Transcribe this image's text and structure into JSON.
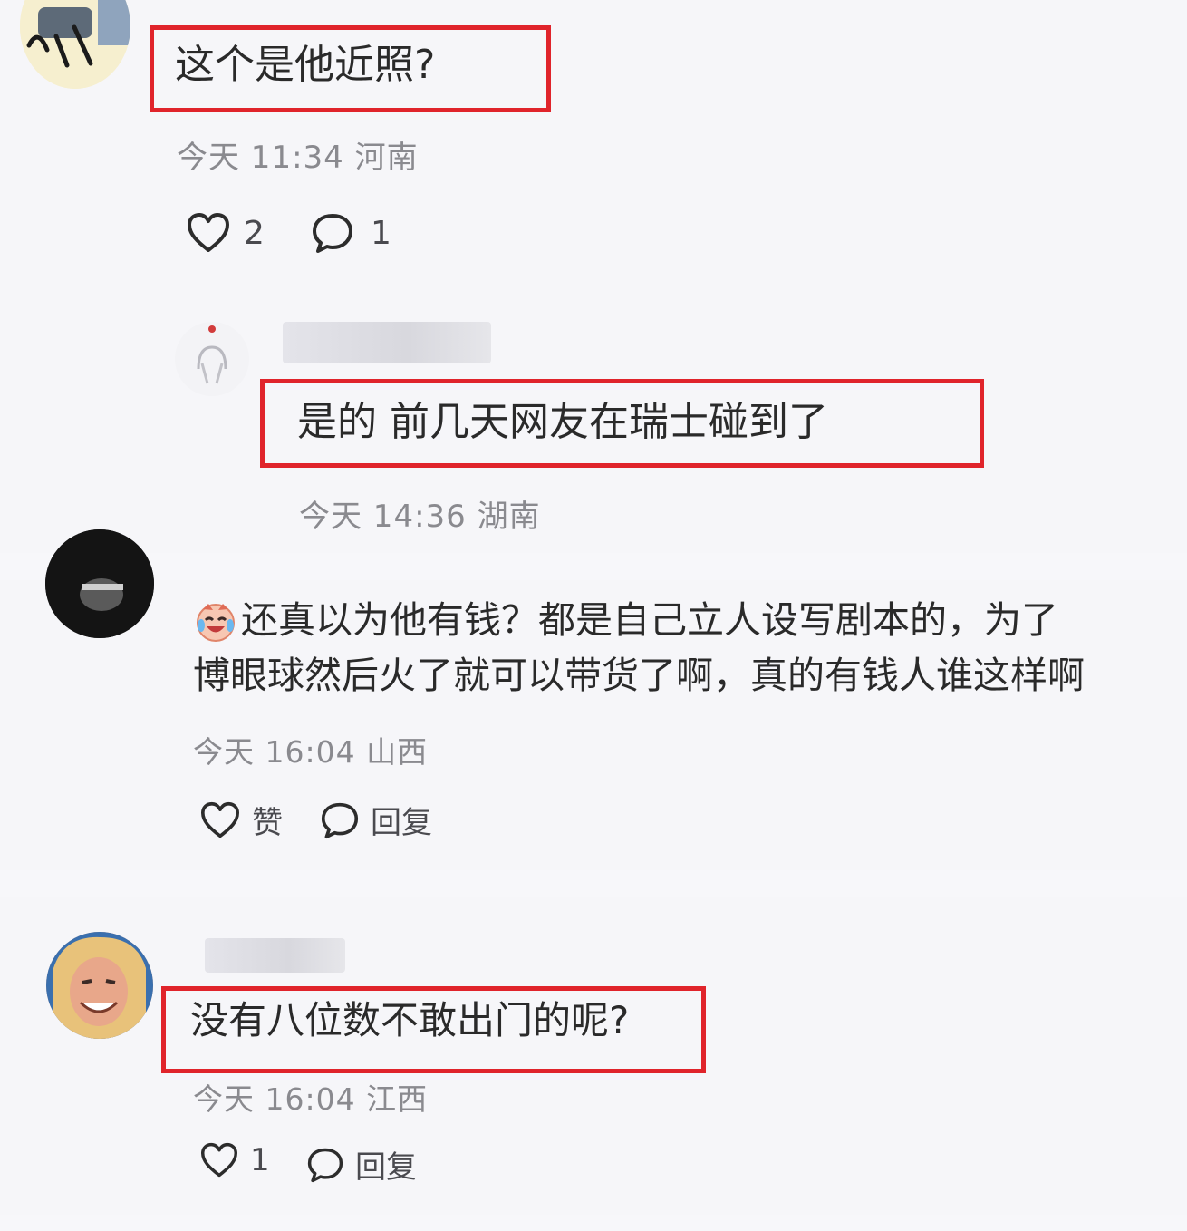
{
  "comments": [
    {
      "text": "这个是他近照?",
      "meta": "今天 11:34 河南",
      "like_label": "2",
      "reply_label": "1",
      "replies": [
        {
          "text": "是的 前几天网友在瑞士碰到了",
          "meta": "今天 14:36 湖南"
        }
      ]
    },
    {
      "emoji": "crying-laughing-emoji",
      "line1": "还真以为他有钱？都是自己立人设写剧本的，为了",
      "line2": "博眼球然后火了就可以带货了啊，真的有钱人谁这样啊",
      "meta": "今天 16:04 山西",
      "like_label": "赞",
      "reply_label": "回复"
    },
    {
      "text": "没有八位数不敢出门的呢?",
      "meta": "今天 16:04 江西",
      "like_label": "1",
      "reply_label": "回复"
    }
  ],
  "colors": {
    "highlight": "#e0242b",
    "meta": "#8a8a8f",
    "background": "#f6f6f9"
  }
}
